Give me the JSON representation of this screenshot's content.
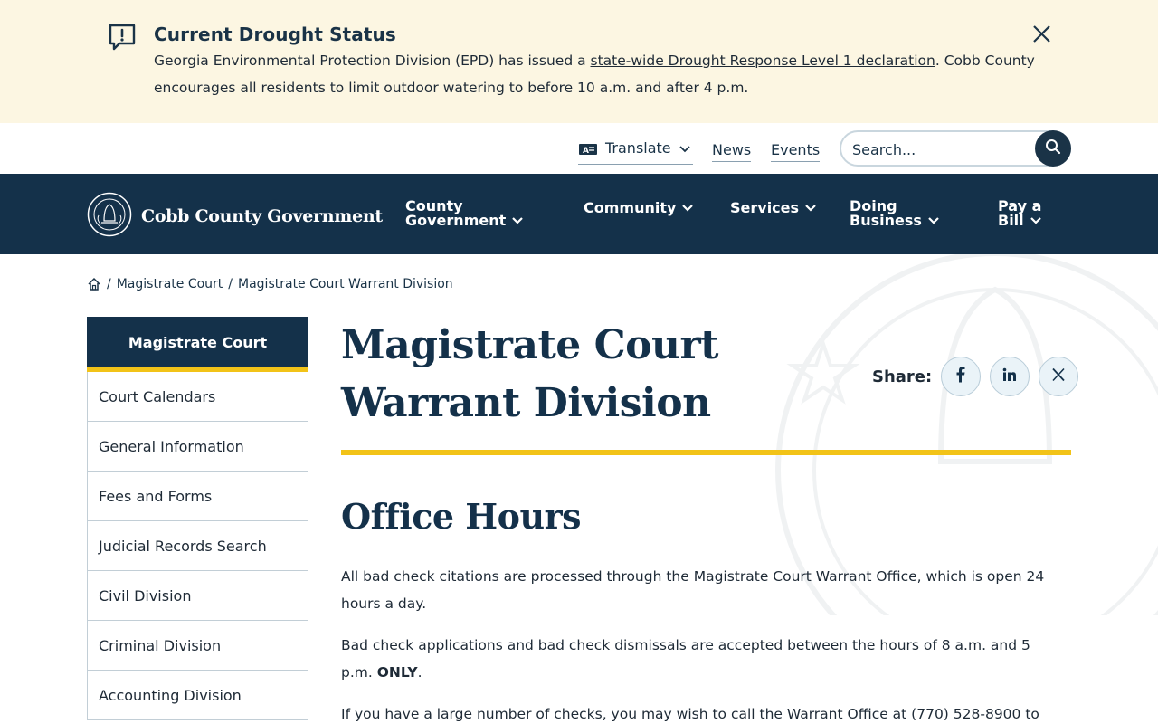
{
  "alert": {
    "title": "Current Drought Status",
    "body_before": "Georgia Environmental Protection Division (EPD) has issued a ",
    "link_text": "state-wide Drought Response Level 1 declaration",
    "body_after": ". Cobb County encourages all residents to limit outdoor watering to before 10 a.m. and after 4 p.m."
  },
  "utility": {
    "translate_label": "Translate",
    "news_label": "News",
    "events_label": "Events",
    "search_placeholder": "Search..."
  },
  "nav": {
    "logo_text": "Cobb County Government",
    "items": [
      {
        "line1": "County",
        "line2": "Government"
      },
      {
        "line1": "Community",
        "line2": ""
      },
      {
        "line1": "Services",
        "line2": ""
      },
      {
        "line1": "Doing",
        "line2": "Business"
      },
      {
        "line1": "Pay a",
        "line2": "Bill"
      }
    ]
  },
  "breadcrumb": {
    "items": [
      "Magistrate Court",
      "Magistrate Court Warrant Division"
    ]
  },
  "sidebar": {
    "heading": "Magistrate Court",
    "items": [
      {
        "label": "Court Calendars"
      },
      {
        "label": "General Information"
      },
      {
        "label": "Fees and Forms"
      },
      {
        "label": "Judicial Records Search"
      },
      {
        "label": "Civil Division"
      },
      {
        "label": "Criminal Division"
      },
      {
        "label": "Accounting Division"
      }
    ]
  },
  "main": {
    "title": "Magistrate Court Warrant Division",
    "share_label": "Share:",
    "section_heading": "Office Hours",
    "para1": "All bad check citations are processed through the Magistrate Court Warrant Office, which is open 24 hours a day.",
    "para2_before": "Bad check applications and bad check dismissals are accepted between the hours of 8 a.m. and 5 p.m. ",
    "para2_bold": "ONLY",
    "para2_after": ".",
    "para3": "If you have a large number of checks, you may wish to call the Warrant Office at (770) 528-8900 to"
  },
  "colors": {
    "navy": "#14314a",
    "gold": "#f2c318",
    "alert_bg": "#fcf6e2"
  }
}
